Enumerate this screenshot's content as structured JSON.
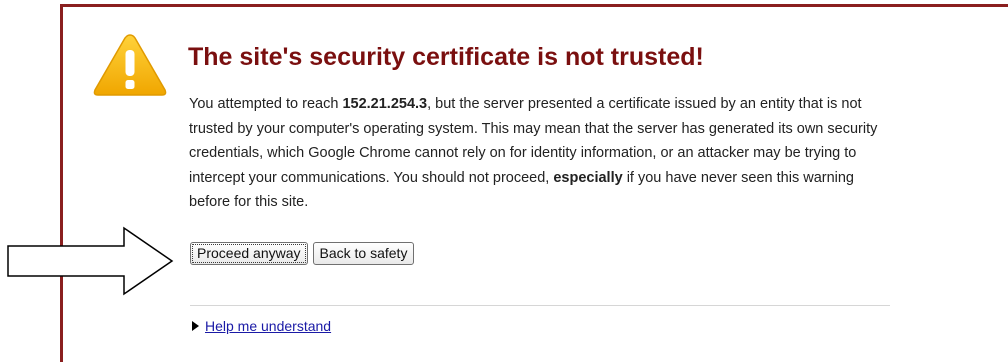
{
  "warning": {
    "icon": "warning-triangle-icon",
    "colors": {
      "fill": "#f5b800",
      "edge": "#e09a00",
      "mark": "#ffffff"
    }
  },
  "title": "The site's security certificate is not trusted!",
  "message": {
    "part1": "You attempted to reach ",
    "host": "152.21.254.3",
    "part2": ", but the server presented a certificate issued by an entity that is not trusted by your computer's operating system. This may mean that the server has generated its own security credentials, which Google Chrome cannot rely on for identity information, or an attacker may be trying to intercept your communications. You should not proceed, ",
    "emphasis": "especially",
    "part3": " if you have never seen this warning before for this site."
  },
  "buttons": {
    "proceed_label": "Proceed anyway",
    "back_label": "Back to safety"
  },
  "help": {
    "icon": "triangle-right-icon",
    "label": "Help me understand"
  },
  "annotation": {
    "icon": "outline-arrow-right-icon"
  },
  "colors": {
    "frame": "#8a1f1f",
    "title": "#7a0f0f",
    "link": "#1a1aa6"
  }
}
